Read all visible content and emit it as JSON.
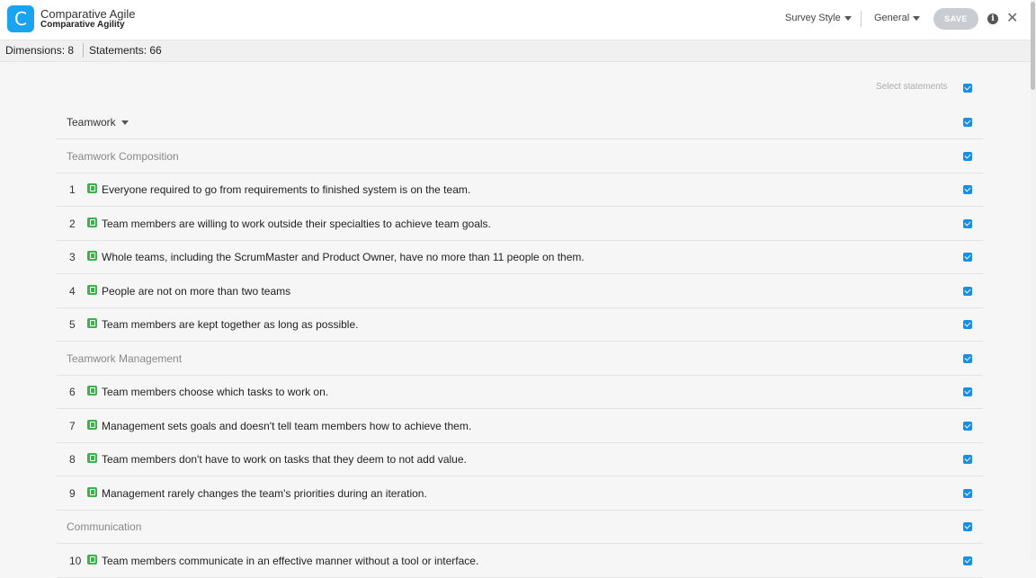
{
  "header": {
    "app_title": "Comparative Agile",
    "app_subtitle": "Comparative Agility",
    "logo_letter": "C",
    "survey_style_label": "Survey Style",
    "general_label": "General",
    "save_label": "SAVE",
    "info_glyph": "i",
    "close_glyph": "✕"
  },
  "subbar": {
    "dimensions": "Dimensions: 8",
    "statements": "Statements: 66"
  },
  "select_statements_label": "Select statements",
  "dimension": {
    "label": "Teamwork"
  },
  "rows": [
    {
      "type": "sub",
      "text": "Teamwork Composition"
    },
    {
      "type": "st",
      "num": "1",
      "text": "Everyone required to go from requirements to finished system is on the team."
    },
    {
      "type": "st",
      "num": "2",
      "text": "Team members are willing to work outside their specialties to achieve team goals."
    },
    {
      "type": "st",
      "num": "3",
      "text": "Whole teams, including the ScrumMaster and Product Owner, have no more than 11 people on them."
    },
    {
      "type": "st",
      "num": "4",
      "text": "People are not on more than two teams"
    },
    {
      "type": "st",
      "num": "5",
      "text": "Team members are kept together as long as possible."
    },
    {
      "type": "sub",
      "text": "Teamwork Management"
    },
    {
      "type": "st",
      "num": "6",
      "text": "Team members choose which tasks to work on."
    },
    {
      "type": "st",
      "num": "7",
      "text": "Management sets goals and doesn't tell team members how to achieve them."
    },
    {
      "type": "st",
      "num": "8",
      "text": "Team members don't have to work on tasks that they deem to not add value."
    },
    {
      "type": "st",
      "num": "9",
      "text": "Management rarely changes the team's priorities during an iteration."
    },
    {
      "type": "sub",
      "text": "Communication"
    },
    {
      "type": "st",
      "num": "10",
      "text": "Team members communicate in an effective manner without a tool or interface."
    }
  ],
  "colors": {
    "accent": "#1a8fe0",
    "logo": "#1aa3ef",
    "edit_icon": "#3cb34a"
  }
}
